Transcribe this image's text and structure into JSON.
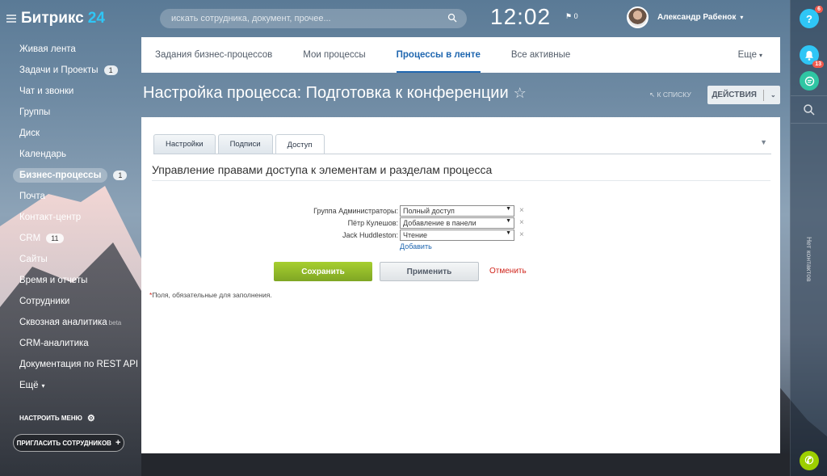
{
  "app": {
    "logo_text": "Битрикс",
    "logo_num": "24"
  },
  "header": {
    "search_placeholder": "искать сотрудника, документ, прочее...",
    "time": "12:02",
    "flag_count": "0",
    "user_name": "Александр Рабенок"
  },
  "left_menu": {
    "items": [
      {
        "label": "Живая лента"
      },
      {
        "label": "Задачи и Проекты",
        "counter": "1"
      },
      {
        "label": "Чат и звонки"
      },
      {
        "label": "Группы"
      },
      {
        "label": "Диск"
      },
      {
        "label": "Календарь"
      },
      {
        "label": "Бизнес-процессы",
        "counter": "1",
        "active": true
      },
      {
        "label": "Почта"
      },
      {
        "label": "Контакт-центр"
      },
      {
        "label": "CRM",
        "counter": "11"
      },
      {
        "label": "Сайты"
      },
      {
        "label": "Время и отчеты"
      },
      {
        "label": "Сотрудники"
      },
      {
        "label": "Сквозная аналитика",
        "beta": "beta"
      },
      {
        "label": "CRM-аналитика"
      },
      {
        "label": "Документация по REST API"
      },
      {
        "label": "Ещё"
      }
    ],
    "settings_label": "НАСТРОИТЬ МЕНЮ",
    "invite_label": "ПРИГЛАСИТЬ СОТРУДНИКОВ"
  },
  "top_tabs": {
    "tabs": [
      "Задания бизнес-процессов",
      "Мои процессы",
      "Процессы в ленте",
      "Все активные"
    ],
    "active_index": 2,
    "more_label": "Еще"
  },
  "page": {
    "title": "Настройка процесса: Подготовка к конференции",
    "to_list": "К СПИСКУ",
    "actions_label": "ДЕЙСТВИЯ"
  },
  "content": {
    "inner_tabs": [
      "Настройки",
      "Подписи",
      "Доступ"
    ],
    "active_inner_tab": 2,
    "section_title": "Управление правами доступа к элементам и разделам процесса",
    "rights": [
      {
        "label": "Группа Администраторы:",
        "value": "Полный доступ"
      },
      {
        "label": "Пётр Кулешов:",
        "value": "Добавление в панели"
      },
      {
        "label": "Jack Huddleston:",
        "value": "Чтение"
      }
    ],
    "add_label": "Добавить",
    "save_label": "Сохранить",
    "apply_label": "Применить",
    "cancel_label": "Отменить",
    "required_note": "Поля, обязательные для заполнения."
  },
  "right_rail": {
    "help_badge": "6",
    "notify_badge": "13",
    "no_contacts": "Нет контактов"
  },
  "colors": {
    "accent": "#2067b0",
    "save_green": "#9dcf00",
    "cancel_red": "#d0241b",
    "rail_blue": "#2fc6f6"
  }
}
